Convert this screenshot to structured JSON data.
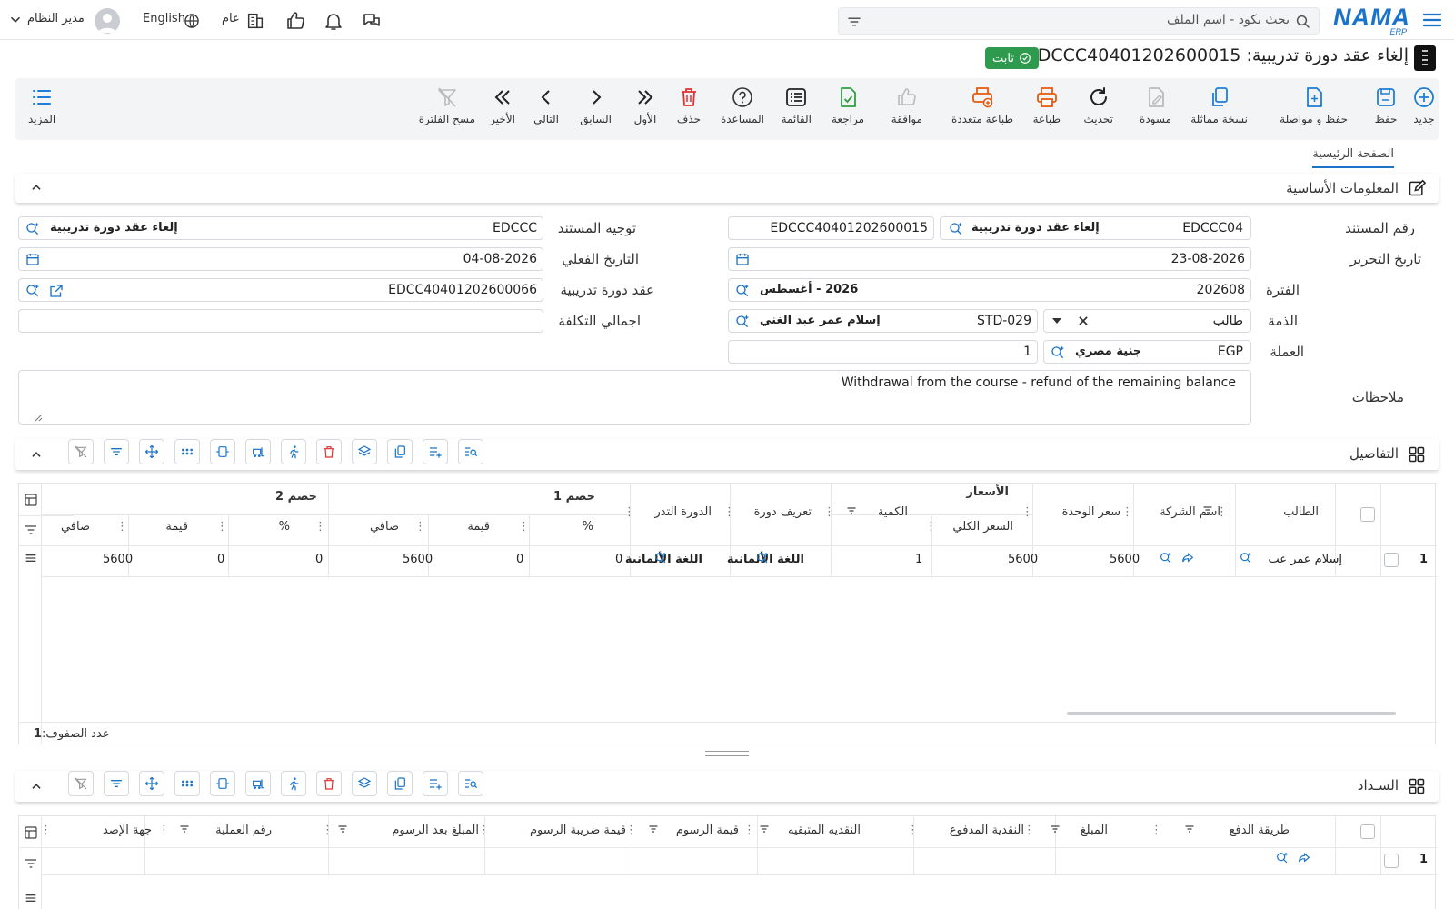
{
  "topbar": {
    "logo_text": "NAMA",
    "logo_sub": "ERP",
    "search_placeholder": "بحث بكود - اسم الملف",
    "branch": "عام",
    "language": "English",
    "user": "مدير النظام"
  },
  "document": {
    "title": "إلغاء عقد دورة تدريبية: EDCCC40401202600015",
    "status": "ثابت"
  },
  "toolbar": {
    "new": "جديد",
    "save": "حفظ",
    "save_continue": "حفظ و مواصلة",
    "duplicate": "نسخة مماثلة",
    "draft": "مسودة",
    "refresh": "تحديث",
    "print": "طباعة",
    "multi_print": "طباعة متعددة",
    "approve": "موافقة",
    "review": "مراجعة",
    "list": "القائمة",
    "help": "المساعدة",
    "delete": "حذف",
    "first": "الأول",
    "previous": "السابق",
    "next": "التالي",
    "last": "الأخير",
    "clear_filter": "مسح الفلترة",
    "more": "المزيد"
  },
  "tabs": {
    "main": "الصفحة الرئيسية"
  },
  "basic_info": {
    "section_title": "المعلومات الأساسية",
    "doc_number_label": "رقم المستند",
    "doc_book_code": "EDCCC04",
    "doc_book_name": "إلغاء عقد دورة تدريبية",
    "doc_number": "EDCCC40401202600015",
    "doc_direction_label": "توجيه المستند",
    "doc_direction_code": "EDCCC",
    "doc_direction_name": "إلغاء عقد دورة تدريبية",
    "edit_date_label": "تاريخ التحرير",
    "edit_date": "23-08-2026",
    "actual_date_label": "التاريخ الفعلي",
    "actual_date": "04-08-2026",
    "period_label": "الفترة",
    "period_code": "202608",
    "period_name": "2026 - أغسطس",
    "contract_label": "عقد دورة تدريبية",
    "contract_value": "EDCC40401202600066",
    "subsidiary_label": "الذمة",
    "subsidiary_type": "طالب",
    "subsidiary_code": "STD-029",
    "subsidiary_name": "إسلام عمر عبد الغني",
    "total_cost_label": "اجمالي التكلفة",
    "total_cost": "",
    "currency_label": "العملة",
    "currency_code": "EGP",
    "currency_name": "جنية مصري",
    "currency_rate": "1",
    "notes_label": "ملاحظات",
    "notes": "Withdrawal from the course - refund of the remaining balance"
  },
  "details": {
    "section_title": "التفاصيل",
    "group_prices": "الأسعار",
    "group_discount1": "خصم 1",
    "group_discount2": "خصم 2",
    "columns": {
      "student": "الطالب",
      "company": "اسم الشركة",
      "unit_price": "سعر الوحدة",
      "total_price": "السعر الكلي",
      "quantity": "الكمية",
      "course_def": "تعريف دورة",
      "training_course": "الدورة التدر",
      "d1_percent": "%",
      "d1_value": "قيمة",
      "d1_net": "صافي",
      "d2_percent": "%",
      "d2_value": "قيمة",
      "d2_net": "صافي"
    },
    "rows": [
      {
        "no": "1",
        "student": "إسلام عمر عب",
        "unit_price": "5600",
        "total_price": "5600",
        "quantity": "1",
        "course_def": "اللغة الألمانية",
        "training_course": "اللغة الألمانية",
        "d1_percent": "0",
        "d1_value": "0",
        "d1_net": "5600",
        "d2_percent": "0",
        "d2_value": "0",
        "d2_net": "5600"
      }
    ],
    "row_count_label": "عدد الصفوف:",
    "row_count": "1"
  },
  "payment": {
    "section_title": "السـداد",
    "columns": {
      "pay_method": "طريقة الدفع",
      "amount": "المبلغ",
      "cash_paid": "النقدية المدفوع",
      "cash_remaining": "النقديه المتبقيه",
      "fees_value": "قيمة الرسوم",
      "fees_tax": "قيمة ضريبة الرسوم",
      "amount_after_fees": "المبلغ بعد الرسوم",
      "operation_no": "رقم العملية",
      "issuer": "جهة الإصد"
    },
    "rows": [
      {
        "no": "1"
      }
    ]
  },
  "colors": {
    "brand": "#1a73c9",
    "status_green": "#2e9a4e",
    "print_orange": "#e8590c",
    "delete_red": "#e03131",
    "review_green": "#2f9e44",
    "new_blue": "#1c7ed6"
  }
}
